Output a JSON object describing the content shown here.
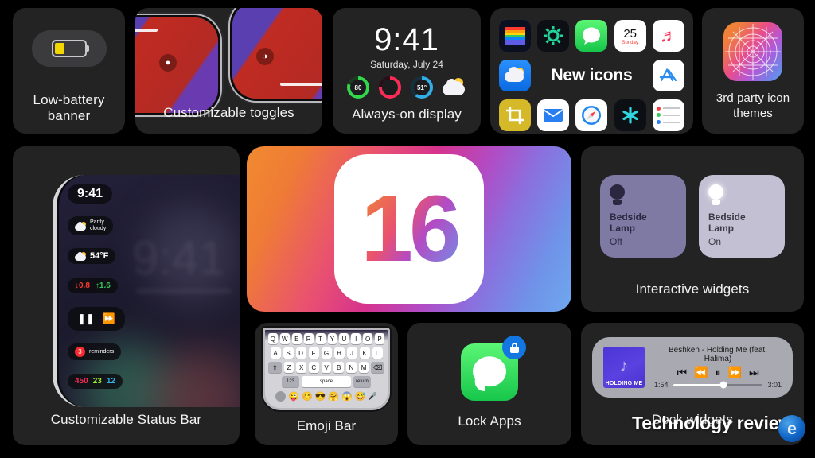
{
  "page": {
    "background_color": "#000000",
    "tile_color": "#232323",
    "label_color": "#f2f2f2"
  },
  "tiles": {
    "battery": {
      "label_line1": "Low-battery",
      "label_line2": "banner",
      "battery_level_percent": 34,
      "battery_fill_color": "#f2d701"
    },
    "toggles": {
      "label": "Customizable toggles",
      "toggle_icons": [
        "flashlight-icon",
        "dark-mode-icon"
      ]
    },
    "aod": {
      "label": "Always-on display",
      "time": "9:41",
      "date": "Saturday, July 24",
      "widgets": [
        {
          "name": "battery-ring",
          "value": "80",
          "color": "#32d74b"
        },
        {
          "name": "activity-rings",
          "value": "",
          "color": "#fa2b56"
        },
        {
          "name": "temperature-ring",
          "value": "51°",
          "color": "#32ade6"
        },
        {
          "name": "weather-icon",
          "value": "",
          "color": "#f2f2f7"
        }
      ]
    },
    "newicons": {
      "headline": "New icons",
      "apps": [
        {
          "name": "photos-icon",
          "bg": "#0b1020",
          "glyph": ""
        },
        {
          "name": "settings-icon",
          "bg": "#0c1014",
          "glyph": "✻"
        },
        {
          "name": "messages-icon",
          "bg": "#2fd45c",
          "glyph": ""
        },
        {
          "name": "calendar-icon",
          "bg": "#ffffff",
          "glyph": "25",
          "sub": "Sunday"
        },
        {
          "name": "music-icon",
          "bg": "#ffffff",
          "glyph": "♬"
        },
        {
          "name": "weather-icon",
          "bg": "#1a7ef0",
          "glyph": ""
        },
        {
          "name": "appstore-icon",
          "bg": "#ffffff",
          "glyph": "A"
        },
        {
          "name": "crop-icon",
          "bg": "#d6b928",
          "glyph": "⌗"
        },
        {
          "name": "mail-icon",
          "bg": "#ffffff",
          "glyph": "✉"
        },
        {
          "name": "safari-icon",
          "bg": "#ffffff",
          "glyph": ""
        },
        {
          "name": "shortcuts-icon",
          "bg": "#0c1014",
          "glyph": "✳"
        },
        {
          "name": "reminders-icon",
          "bg": "#ffffff",
          "glyph": ""
        }
      ]
    },
    "themes": {
      "label_line1": "3rd party icon",
      "label_line2": "themes"
    },
    "statusbar": {
      "label": "Customizable Status Bar",
      "time": "9:41",
      "pills": [
        {
          "name": "weather-condition-pill",
          "text_line1": "Partly",
          "text_line2": "cloudy"
        },
        {
          "name": "temperature-pill",
          "text": "54°F"
        },
        {
          "name": "stocks-pill",
          "down_value": "0.8",
          "up_value": "1.6",
          "down_color": "#ff3b30",
          "up_color": "#34c759"
        },
        {
          "name": "media-controls-pill",
          "text": ""
        },
        {
          "name": "reminders-pill",
          "badge": "3",
          "text": "reminders"
        },
        {
          "name": "activity-pill",
          "move": "450",
          "exercise": "23",
          "stand": "12",
          "move_color": "#fa2b56",
          "exercise_color": "#a0e829",
          "stand_color": "#32ade6"
        }
      ],
      "ghost_time": "9:41"
    },
    "ios16": {
      "version_number": "16",
      "gradient_from": "#f08a30",
      "gradient_mid": "#d6338e",
      "gradient_to": "#6fa8ef"
    },
    "widgets": {
      "label": "Interactive widgets",
      "cards": [
        {
          "name": "bedside-lamp-off",
          "title_line1": "Bedside",
          "title_line2": "Lamp",
          "state": "Off",
          "bg": "#7e7aa3",
          "bulb": "#2b2740",
          "text": "#2b2740"
        },
        {
          "name": "bedside-lamp-on",
          "title_line1": "Bedside",
          "title_line2": "Lamp",
          "state": "On",
          "bg": "#c2c0d2",
          "bulb": "#ffffff",
          "text": "#3a3a46"
        }
      ]
    },
    "emoji": {
      "label": "Emoji Bar",
      "row1": [
        "Q",
        "W",
        "E",
        "R",
        "T",
        "Y",
        "U",
        "I",
        "O",
        "P"
      ],
      "row2": [
        "A",
        "S",
        "D",
        "F",
        "G",
        "H",
        "J",
        "K",
        "L"
      ],
      "row3": [
        "Z",
        "X",
        "C",
        "V",
        "B",
        "N",
        "M"
      ],
      "shift_key": "⇧",
      "backspace_key": "⌫",
      "numeric_key": "123",
      "space_key": "space",
      "return_key": "return",
      "emojis": [
        "😜",
        "😊",
        "😎",
        "🤗",
        "😱",
        "😅"
      ],
      "mic_key": "🎤"
    },
    "lock": {
      "label": "Lock Apps",
      "app": "messages-icon",
      "badge": "lock-icon",
      "badge_color": "#1277e0"
    },
    "dock": {
      "label": "Dock widgets",
      "track_title": "Beshken - Holding Me (feat. Halima)",
      "album_text": "HOLDING ME",
      "elapsed": "1:54",
      "duration": "3:01",
      "progress_percent": 56,
      "transport": [
        "⏮",
        "⏪",
        "⏸",
        "⏩",
        "⏭"
      ]
    }
  },
  "watermark": {
    "text": "Technology review",
    "logo": "blue-circle-e-logo"
  }
}
